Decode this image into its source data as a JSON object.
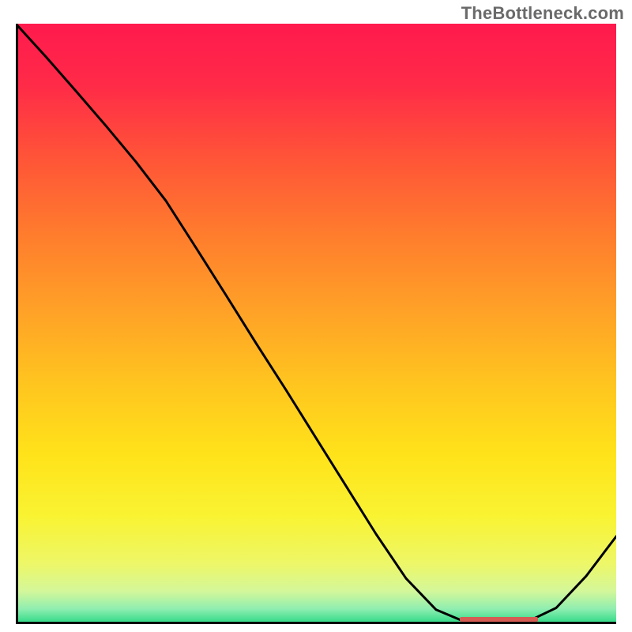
{
  "watermark": {
    "text": "TheBottleneck.com"
  },
  "chart_data": {
    "type": "line",
    "title": "",
    "xlabel": "",
    "ylabel": "",
    "xlim": [
      0,
      100
    ],
    "ylim": [
      0,
      100
    ],
    "x": [
      0,
      5,
      10,
      15,
      20,
      25,
      30,
      35,
      40,
      45,
      50,
      55,
      60,
      65,
      70,
      75,
      80,
      85,
      90,
      95,
      100
    ],
    "y": [
      100,
      94.5,
      88.8,
      83.0,
      77.0,
      70.5,
      62.7,
      54.8,
      46.8,
      39.0,
      31.0,
      23.0,
      15.0,
      7.6,
      2.4,
      0.3,
      0.0,
      0.3,
      2.7,
      8.0,
      14.6
    ],
    "optimal_marker": {
      "x_start": 74,
      "x_end": 87,
      "y": 0.8
    },
    "gradient_stops": [
      {
        "offset": 0.0,
        "color": "#ff1a4d"
      },
      {
        "offset": 0.1,
        "color": "#ff2a48"
      },
      {
        "offset": 0.22,
        "color": "#ff5338"
      },
      {
        "offset": 0.35,
        "color": "#ff7c2d"
      },
      {
        "offset": 0.48,
        "color": "#ffa227"
      },
      {
        "offset": 0.6,
        "color": "#ffc51f"
      },
      {
        "offset": 0.72,
        "color": "#ffe31a"
      },
      {
        "offset": 0.82,
        "color": "#f9f332"
      },
      {
        "offset": 0.9,
        "color": "#edf768"
      },
      {
        "offset": 0.945,
        "color": "#d4f79a"
      },
      {
        "offset": 0.975,
        "color": "#8eeeb0"
      },
      {
        "offset": 1.0,
        "color": "#28d884"
      }
    ]
  }
}
